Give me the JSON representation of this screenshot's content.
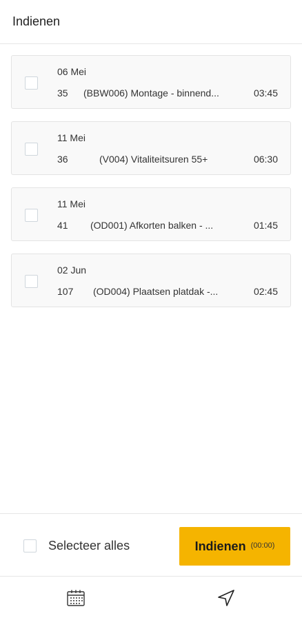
{
  "header": {
    "title": "Indienen"
  },
  "entries": [
    {
      "date": "06 Mei",
      "number": "35",
      "description": "(BBW006) Montage - binnend...",
      "duration": "03:45"
    },
    {
      "date": "11 Mei",
      "number": "36",
      "description": "(V004) Vitaliteitsuren 55+",
      "duration": "06:30"
    },
    {
      "date": "11 Mei",
      "number": "41",
      "description": "(OD001) Afkorten balken - ...",
      "duration": "01:45"
    },
    {
      "date": "02 Jun",
      "number": "107",
      "description": "(OD004) Plaatsen platdak -...",
      "duration": "02:45"
    }
  ],
  "footer": {
    "select_all_label": "Selecteer alles",
    "submit_label": "Indienen",
    "submit_total": "(00:00)"
  },
  "nav": {
    "items": [
      {
        "icon": "calendar-icon"
      },
      {
        "icon": "send-icon"
      }
    ]
  },
  "colors": {
    "accent": "#f5b400",
    "card_bg": "#f9f9f9",
    "border": "#e3e3e3"
  }
}
